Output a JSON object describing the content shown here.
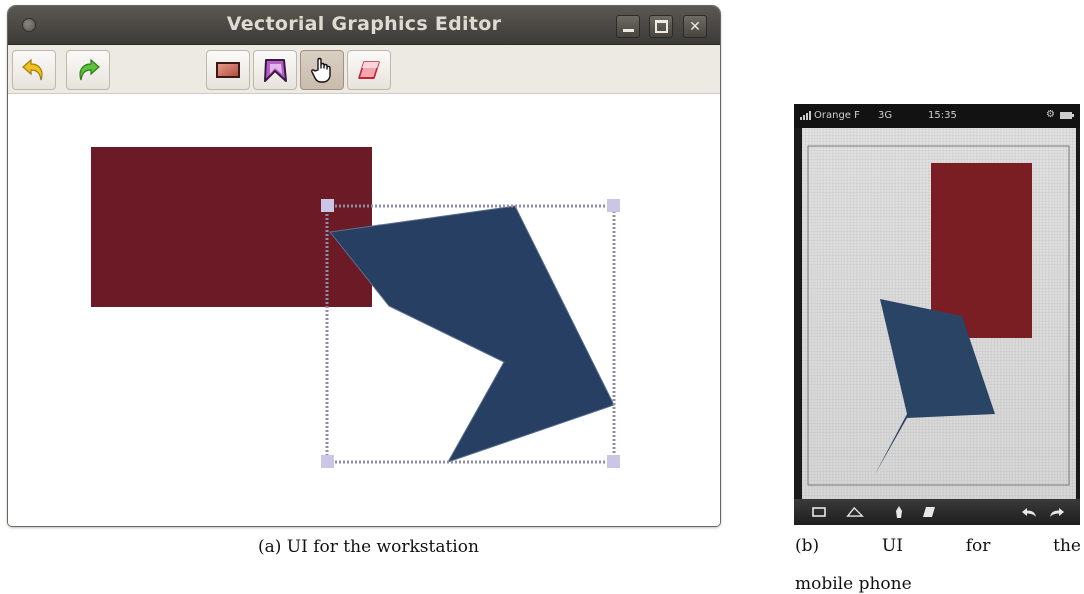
{
  "desktop": {
    "window_title": "Vectorial Graphics Editor",
    "window_buttons": [
      "minimize",
      "maximize",
      "close"
    ],
    "toolbar": {
      "history_tools": [
        {
          "name": "undo",
          "icon": "undo-arrow-icon"
        },
        {
          "name": "redo",
          "icon": "redo-arrow-icon"
        }
      ],
      "drawing_tools": [
        {
          "name": "rectangle",
          "icon": "rectangle-icon"
        },
        {
          "name": "polygon",
          "icon": "polygon-icon"
        },
        {
          "name": "select",
          "icon": "hand-cursor-icon",
          "active": true
        },
        {
          "name": "eraser",
          "icon": "eraser-icon"
        }
      ]
    },
    "shapes": [
      {
        "type": "rectangle",
        "color": "#6b1a26"
      },
      {
        "type": "polygon",
        "color": "#263f63",
        "selected": true
      }
    ],
    "selection_color": "#8d8da8"
  },
  "mobile": {
    "status": {
      "carrier": "Orange F",
      "network": "3G",
      "time": "15:35"
    },
    "shapes": [
      {
        "type": "rectangle",
        "color": "#7a1e23"
      },
      {
        "type": "polygon",
        "color": "#2a4466"
      }
    ],
    "toolbar": {
      "tools": [
        "rectangle-icon",
        "polygon-icon",
        "hand-icon",
        "eraser-icon"
      ],
      "history": [
        "undo-icon",
        "redo-icon"
      ]
    }
  },
  "captions": {
    "a": "(a) UI for the workstation",
    "b": "(b) UI for the mobile phone"
  }
}
